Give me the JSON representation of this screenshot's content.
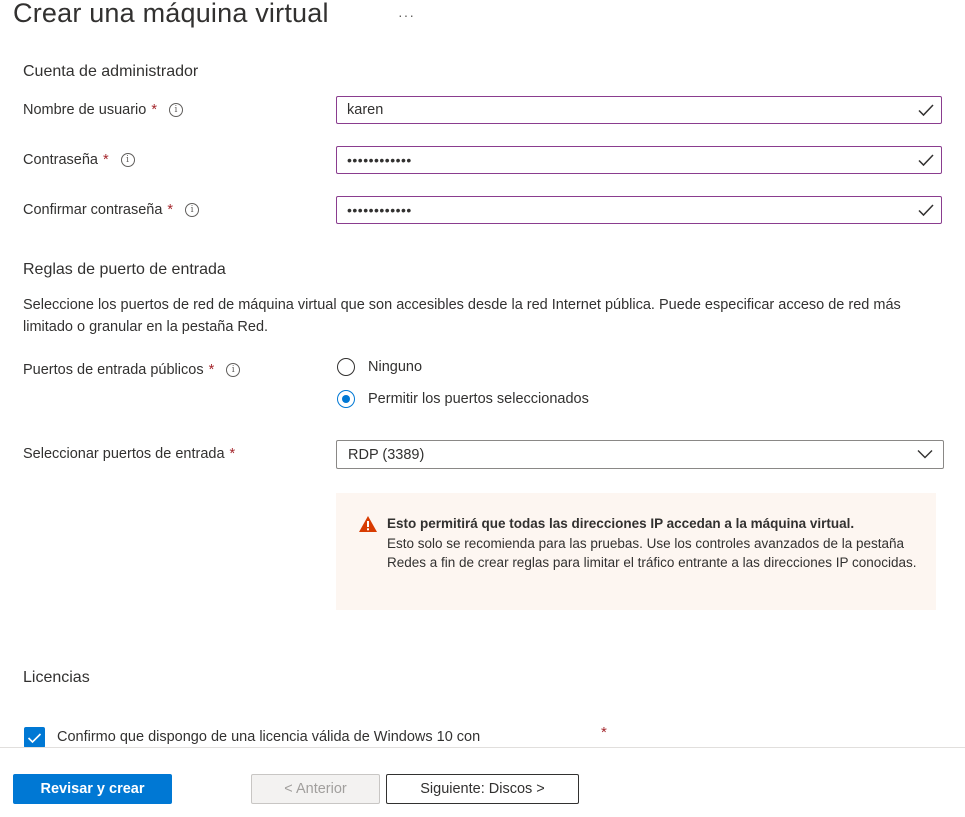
{
  "header": {
    "title": "Crear una máquina virtual",
    "more_label": "···"
  },
  "admin_account": {
    "section_title": "Cuenta de administrador",
    "username": {
      "label": "Nombre de usuario",
      "value": "karen"
    },
    "password": {
      "label": "Contraseña",
      "value": "••••••••••••"
    },
    "confirm_password": {
      "label": "Confirmar contraseña",
      "value": "••••••••••••"
    },
    "required_mark": "*",
    "info_glyph": "i"
  },
  "inbound_rules": {
    "section_title": "Reglas de puerto de entrada",
    "description": "Seleccione los puertos de red de máquina virtual que son accesibles desde la red Internet pública. Puede especificar acceso de red más limitado o granular en la pestaña Red.",
    "public_ports": {
      "label": "Puertos de entrada públicos",
      "options": [
        "Ninguno",
        "Permitir los puertos seleccionados"
      ],
      "selected": "Permitir los puertos seleccionados"
    },
    "select_ports": {
      "label": "Seleccionar puertos de entrada",
      "value": "RDP (3389)"
    },
    "warning": {
      "title": "Esto permitirá que todas las direcciones IP accedan a la máquina virtual.",
      "body": " Esto solo se recomienda para las pruebas.  Use los controles avanzados de la pestaña Redes a fin de crear reglas para limitar el tráfico entrante a las direcciones IP conocidas."
    }
  },
  "licensing": {
    "section_title": "Licencias",
    "confirm_label": "Confirmo que dispongo de una licencia válida de Windows 10 con",
    "checked": true
  },
  "footer": {
    "review_create": "Revisar y crear",
    "previous": "< Anterior",
    "next": "Siguiente: Discos >"
  },
  "colors": {
    "primary": "#0078d4",
    "required": "#a4262c",
    "valid_field_border": "#8a3d8f",
    "warning_bg": "#fdf6f1",
    "warning_icon": "#d83b01"
  }
}
